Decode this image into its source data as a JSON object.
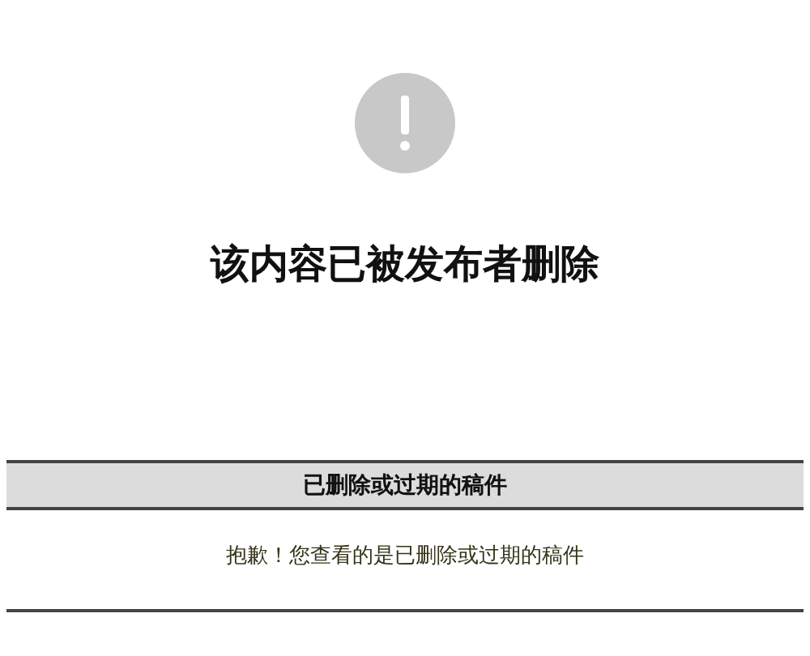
{
  "notice": {
    "title": "该内容已被发布者删除"
  },
  "panel": {
    "header": "已删除或过期的稿件",
    "message": "抱歉！您查看的是已删除或过期的稿件"
  }
}
